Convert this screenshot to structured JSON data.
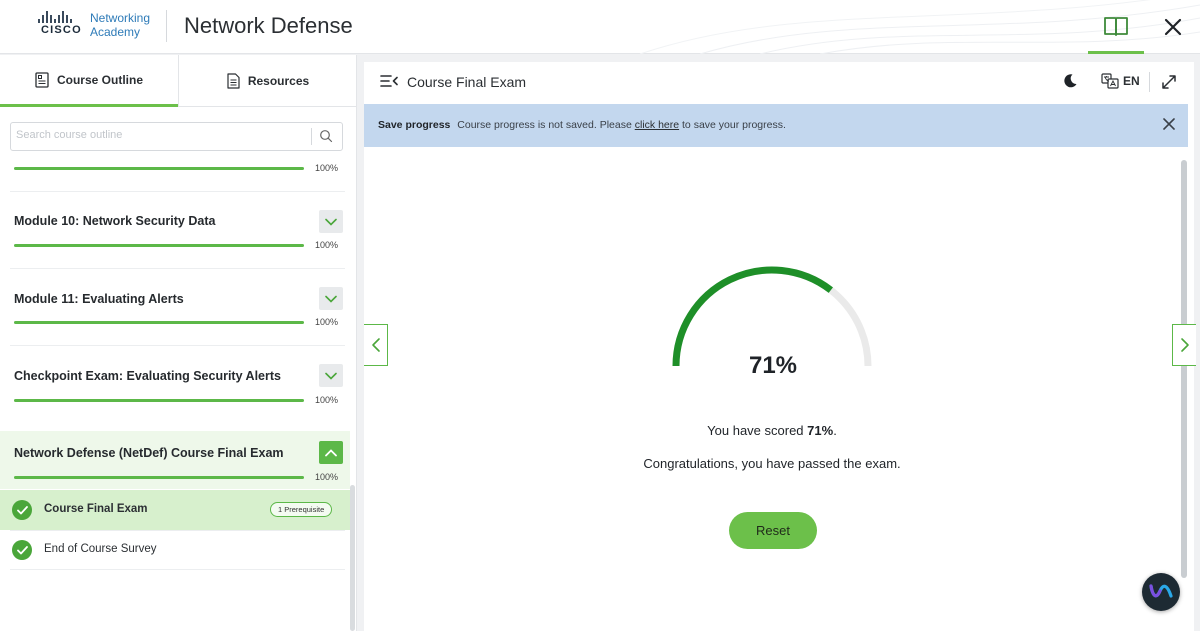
{
  "header": {
    "logo_brand": "CISCO",
    "logo_line1": "Networking",
    "logo_line2": "Academy",
    "title": "Network Defense"
  },
  "sidebar": {
    "tabs": [
      {
        "label": "Course Outline",
        "active": true
      },
      {
        "label": "Resources",
        "active": false
      }
    ],
    "search_placeholder": "Search course outline",
    "top_progress": {
      "value": 100,
      "label": "100%"
    },
    "modules": [
      {
        "title": "Module 10: Network Security Data",
        "progress": 100,
        "pct_label": "100%",
        "expanded": false
      },
      {
        "title": "Module 11: Evaluating Alerts",
        "progress": 100,
        "pct_label": "100%",
        "expanded": false
      },
      {
        "title": "Checkpoint Exam: Evaluating Security Alerts",
        "progress": 100,
        "pct_label": "100%",
        "expanded": false
      },
      {
        "title": "Network Defense (NetDef) Course Final Exam",
        "progress": 100,
        "pct_label": "100%",
        "expanded": true
      }
    ],
    "items": [
      {
        "label": "Course Final Exam",
        "badge": "1 Prerequisite",
        "selected": true,
        "completed": true
      },
      {
        "label": "End of Course Survey",
        "selected": false,
        "completed": true
      }
    ]
  },
  "main": {
    "title": "Course Final Exam",
    "language": "EN",
    "banner": {
      "strong": "Save progress",
      "text_before": "Course progress is not saved. Please",
      "link": "click here",
      "text_after": "to save your progress."
    },
    "score": {
      "value": 71,
      "label": "71%",
      "text_before": "You have scored",
      "text_after": ".",
      "message": "Congratulations, you have passed the exam."
    },
    "reset_label": "Reset"
  },
  "colors": {
    "accent": "#6cc04a",
    "progress": "#5cb848",
    "gauge": "#1e8f28",
    "banner": "#c3d7ee"
  }
}
